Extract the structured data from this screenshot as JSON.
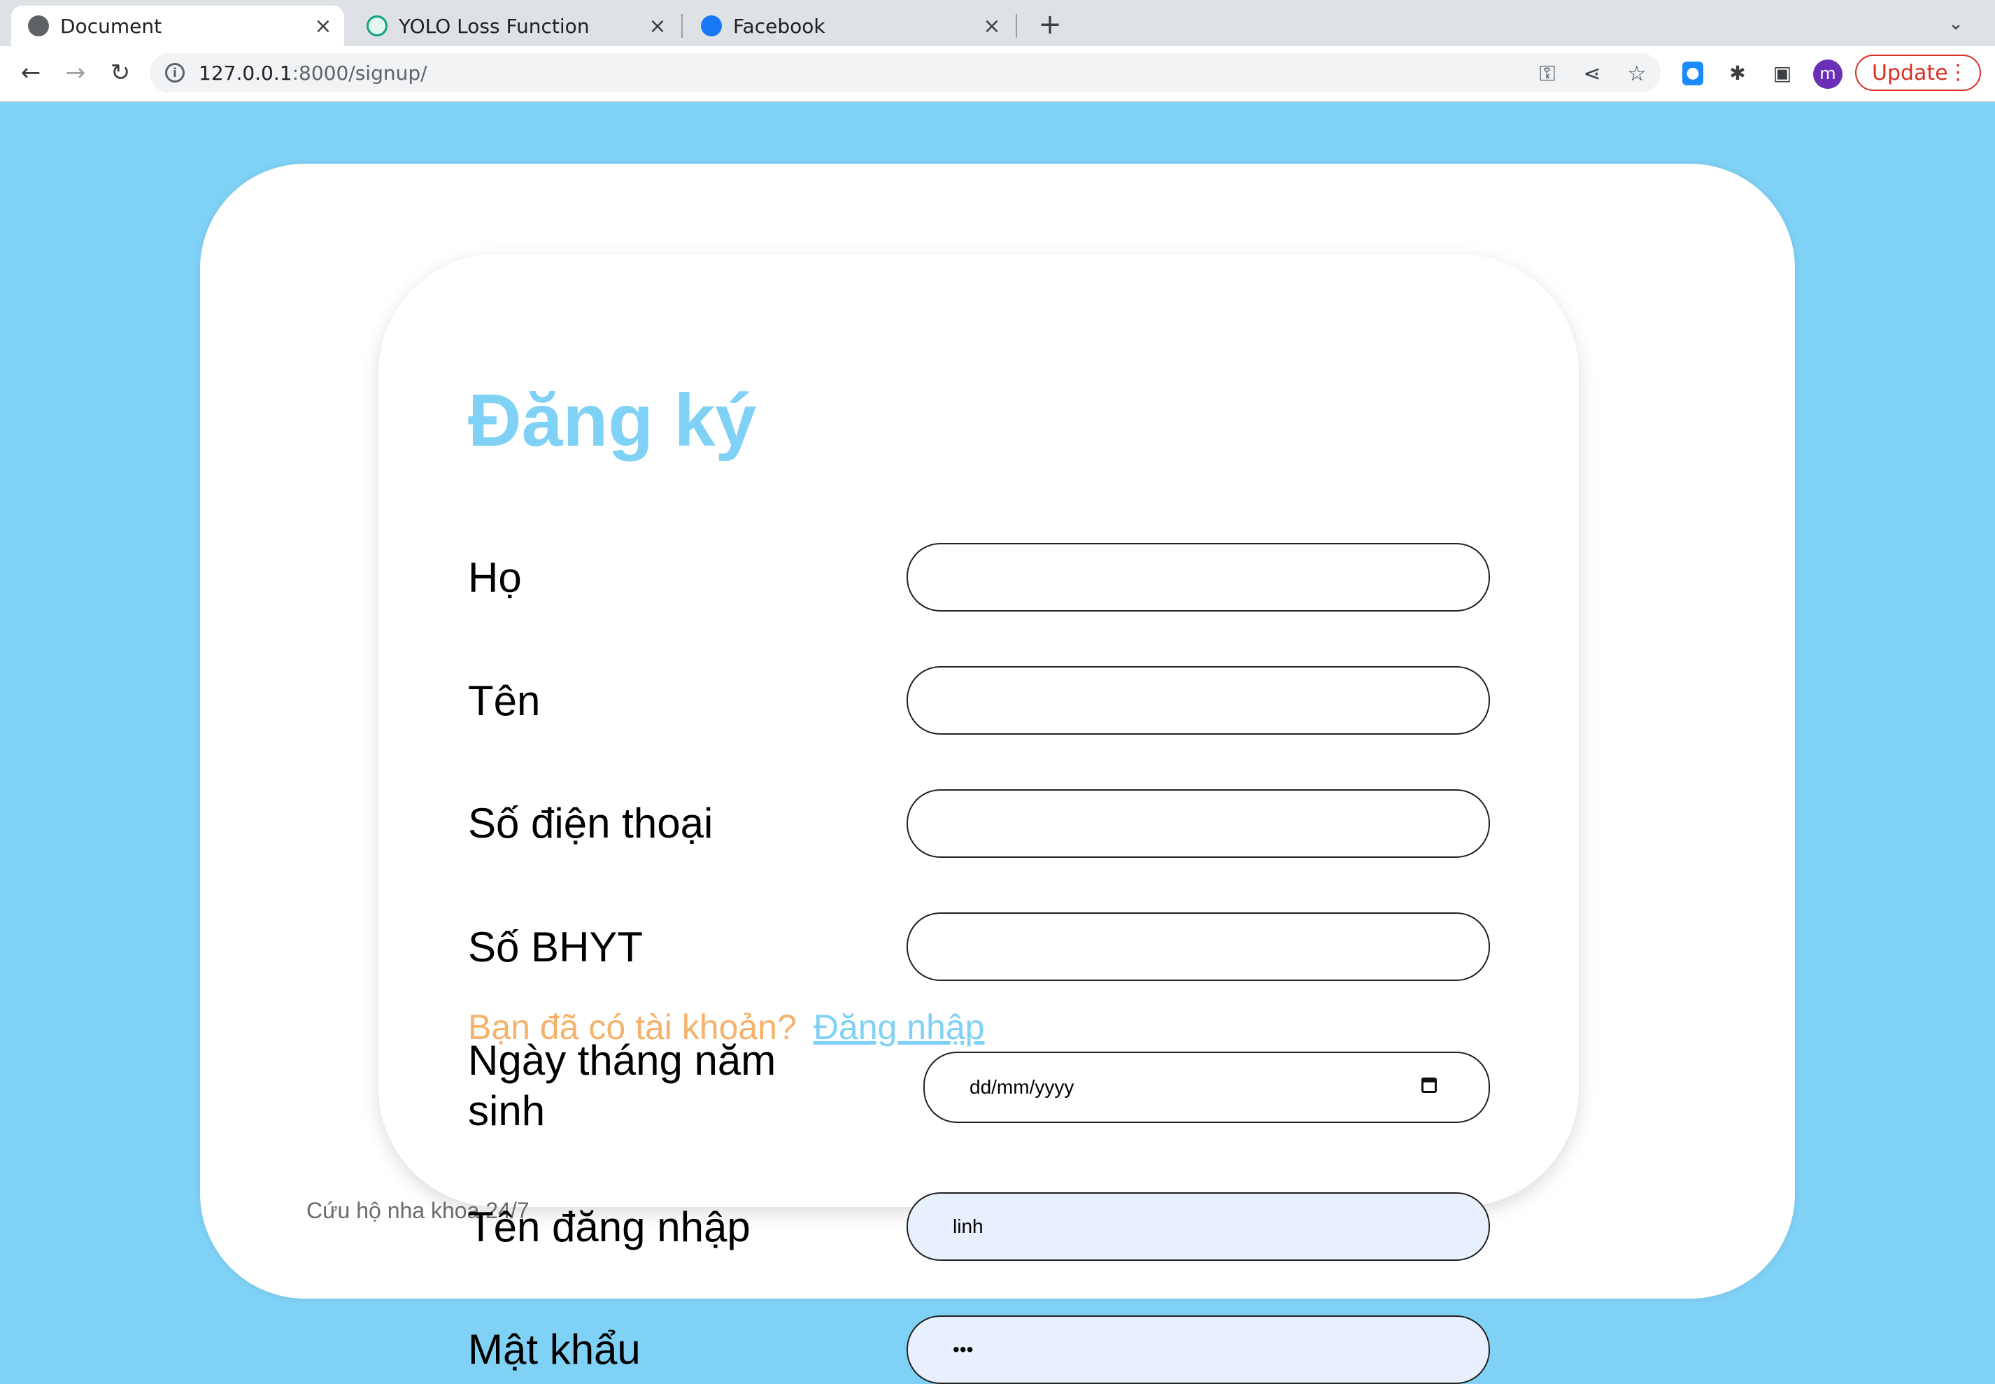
{
  "browser": {
    "tabs": [
      {
        "title": "Document",
        "active": true,
        "icon": "globe-icon"
      },
      {
        "title": "YOLO Loss Function",
        "active": false,
        "icon": "openai-icon"
      },
      {
        "title": "Facebook",
        "active": false,
        "icon": "facebook-icon"
      }
    ],
    "tab_close_glyph": "×",
    "new_tab_glyph": "+",
    "tab_menu_glyph": "⌄",
    "address": {
      "host": "127.0.0.1",
      "path": ":8000/signup/"
    },
    "update_label": "Update",
    "avatar_initial": "m",
    "colors": {
      "update": "#d93025",
      "avatar": "#6a2fb5"
    }
  },
  "page": {
    "background": "#7fd1f5",
    "title": "Đăng ký",
    "fields": [
      {
        "label": "Họ",
        "value": ""
      },
      {
        "label": "Tên",
        "value": ""
      },
      {
        "label": "Số điện thoại",
        "value": ""
      },
      {
        "label": "Số BHYT",
        "value": ""
      },
      {
        "label": "Ngày tháng năm sinh",
        "placeholder": "dd/mm/yyyy",
        "type": "date"
      },
      {
        "label": "Tên đăng nhập",
        "value": "linh"
      },
      {
        "label": "Mật khẩu",
        "value": "•••"
      }
    ],
    "login_prompt": {
      "question": "Bạn đã có tài khoản?",
      "link": "Đăng nhập"
    },
    "footer": "Cứu hộ nha khoa 24/7",
    "colors": {
      "title": "#7fd1f5",
      "question": "#f6b26b",
      "link": "#7fd1f5"
    }
  }
}
